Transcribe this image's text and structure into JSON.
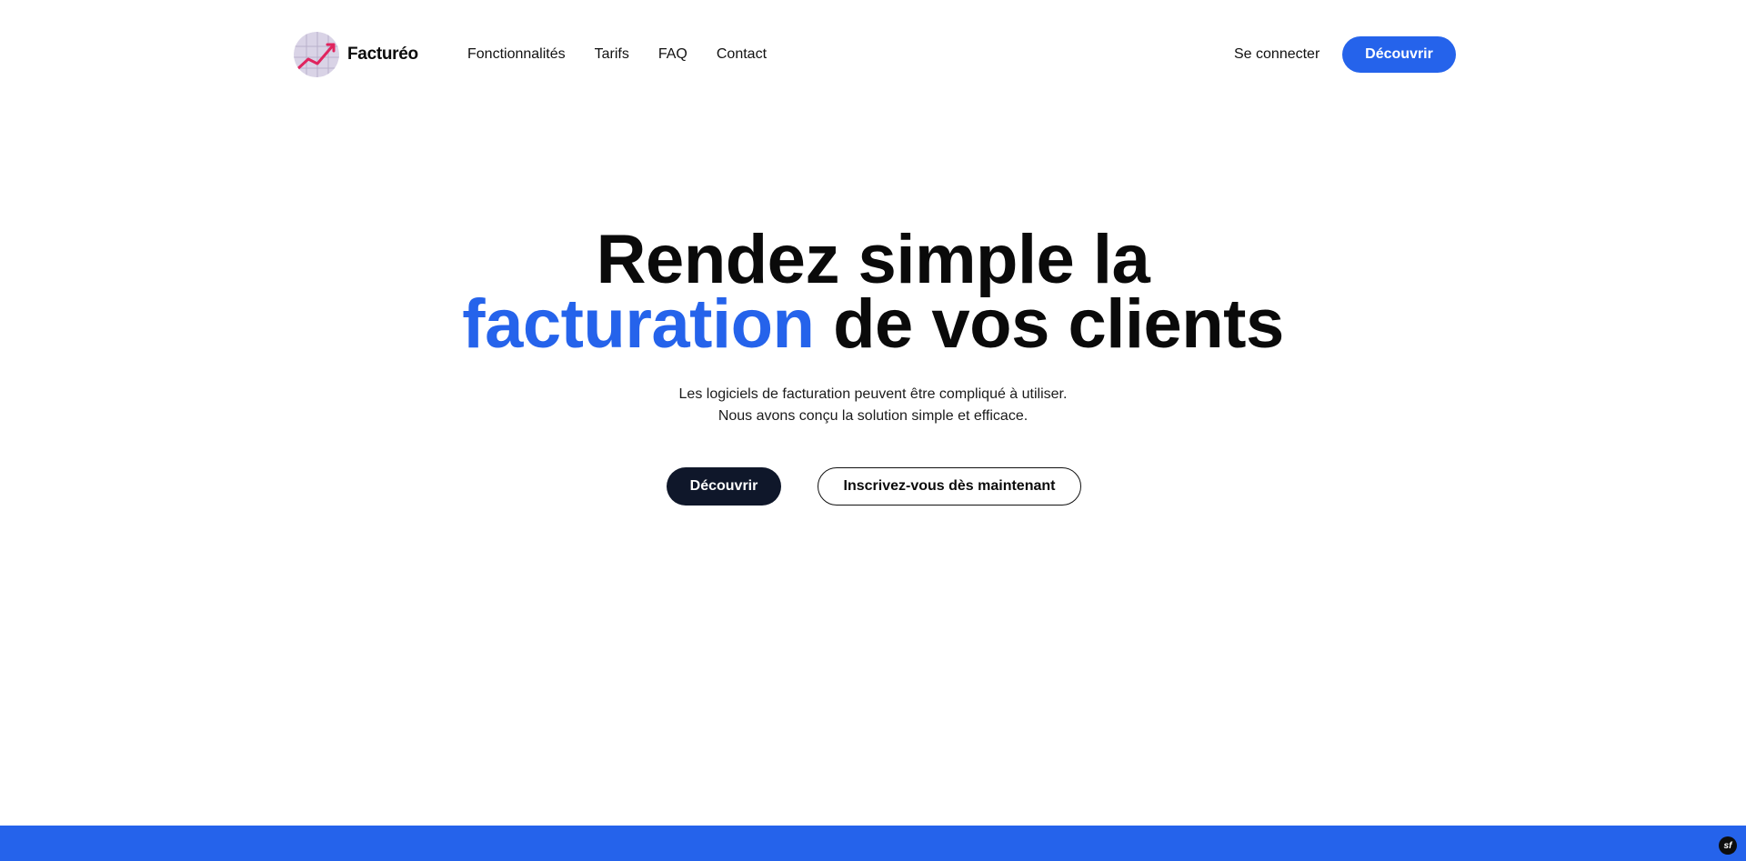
{
  "brand": {
    "name": "Facturéo",
    "logo_icon": "rising-chart-icon"
  },
  "nav": {
    "items": [
      {
        "label": "Fonctionnalités"
      },
      {
        "label": "Tarifs"
      },
      {
        "label": "FAQ"
      },
      {
        "label": "Contact"
      }
    ]
  },
  "header": {
    "login_label": "Se connecter",
    "cta_label": "Découvrir"
  },
  "hero": {
    "title_line1": "Rendez simple la",
    "title_accent": "facturation",
    "title_line2_rest": " de vos clients",
    "subtitle_line1": "Les logiciels de facturation peuvent être compliqué à utiliser.",
    "subtitle_line2": "Nous avons conçu la solution simple et efficace.",
    "primary_button": "Découvrir",
    "secondary_button": "Inscrivez-vous dès maintenant"
  },
  "footer_band": {
    "badge_icon": "symfony-icon",
    "badge_text": "sf"
  },
  "colors": {
    "accent": "#2563eb",
    "dark_button": "#0f172a",
    "logo_line": "#e0245e",
    "logo_bg": "#d9d3e6"
  }
}
